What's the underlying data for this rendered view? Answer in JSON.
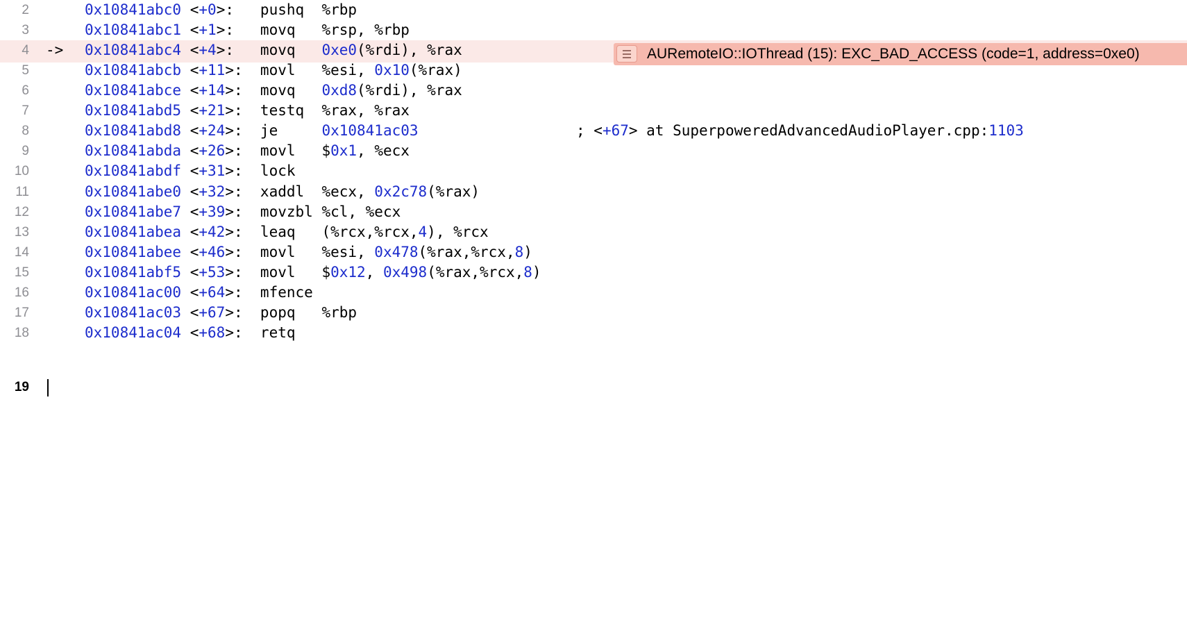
{
  "editor": {
    "lines": [
      {
        "num": "2",
        "arrow": "",
        "addr": "0x10841abc0",
        "offset_prefix": "<",
        "offset": "+0",
        "offset_suffix": ">:",
        "op": "pushq",
        "args": [
          {
            "t": "%rbp",
            "c": "plain"
          }
        ]
      },
      {
        "num": "3",
        "arrow": "",
        "addr": "0x10841abc1",
        "offset_prefix": "<",
        "offset": "+1",
        "offset_suffix": ">:",
        "op": "movq",
        "args": [
          {
            "t": "%rsp, %rbp",
            "c": "plain"
          }
        ]
      },
      {
        "num": "4",
        "arrow": "->",
        "addr": "0x10841abc4",
        "offset_prefix": "<",
        "offset": "+4",
        "offset_suffix": ">:",
        "op": "movq",
        "args": [
          {
            "t": "0xe0",
            "c": "num"
          },
          {
            "t": "(%rdi), %rax",
            "c": "plain"
          }
        ]
      },
      {
        "num": "5",
        "arrow": "",
        "addr": "0x10841abcb",
        "offset_prefix": "<",
        "offset": "+11",
        "offset_suffix": ">:",
        "op": "movl",
        "args": [
          {
            "t": "%esi, ",
            "c": "plain"
          },
          {
            "t": "0x10",
            "c": "num"
          },
          {
            "t": "(%rax)",
            "c": "plain"
          }
        ]
      },
      {
        "num": "6",
        "arrow": "",
        "addr": "0x10841abce",
        "offset_prefix": "<",
        "offset": "+14",
        "offset_suffix": ">:",
        "op": "movq",
        "args": [
          {
            "t": "0xd8",
            "c": "num"
          },
          {
            "t": "(%rdi), %rax",
            "c": "plain"
          }
        ]
      },
      {
        "num": "7",
        "arrow": "",
        "addr": "0x10841abd5",
        "offset_prefix": "<",
        "offset": "+21",
        "offset_suffix": ">:",
        "op": "testq",
        "args": [
          {
            "t": "%rax, %rax",
            "c": "plain"
          }
        ]
      },
      {
        "num": "8",
        "arrow": "",
        "addr": "0x10841abd8",
        "offset_prefix": "<",
        "offset": "+24",
        "offset_suffix": ">:",
        "op": "je",
        "args": [
          {
            "t": "0x10841ac03",
            "c": "num"
          }
        ]
      },
      {
        "num": "9",
        "arrow": "",
        "addr": "0x10841abda",
        "offset_prefix": "<",
        "offset": "+26",
        "offset_suffix": ">:",
        "op": "movl",
        "args": [
          {
            "t": "$",
            "c": "plain"
          },
          {
            "t": "0x1",
            "c": "num"
          },
          {
            "t": ", %ecx",
            "c": "plain"
          }
        ]
      },
      {
        "num": "10",
        "arrow": "",
        "addr": "0x10841abdf",
        "offset_prefix": "<",
        "offset": "+31",
        "offset_suffix": ">:",
        "op": "lock",
        "args": []
      },
      {
        "num": "11",
        "arrow": "",
        "addr": "0x10841abe0",
        "offset_prefix": "<",
        "offset": "+32",
        "offset_suffix": ">:",
        "op": "xaddl",
        "args": [
          {
            "t": "%ecx, ",
            "c": "plain"
          },
          {
            "t": "0x2c78",
            "c": "num"
          },
          {
            "t": "(%rax)",
            "c": "plain"
          }
        ]
      },
      {
        "num": "12",
        "arrow": "",
        "addr": "0x10841abe7",
        "offset_prefix": "<",
        "offset": "+39",
        "offset_suffix": ">:",
        "op": "movzbl",
        "args": [
          {
            "t": "%cl, %ecx",
            "c": "plain"
          }
        ]
      },
      {
        "num": "13",
        "arrow": "",
        "addr": "0x10841abea",
        "offset_prefix": "<",
        "offset": "+42",
        "offset_suffix": ">:",
        "op": "leaq",
        "args": [
          {
            "t": "(%rcx,%rcx,",
            "c": "plain"
          },
          {
            "t": "4",
            "c": "num"
          },
          {
            "t": "), %rcx",
            "c": "plain"
          }
        ]
      },
      {
        "num": "14",
        "arrow": "",
        "addr": "0x10841abee",
        "offset_prefix": "<",
        "offset": "+46",
        "offset_suffix": ">:",
        "op": "movl",
        "args": [
          {
            "t": "%esi, ",
            "c": "plain"
          },
          {
            "t": "0x478",
            "c": "num"
          },
          {
            "t": "(%rax,%rcx,",
            "c": "plain"
          },
          {
            "t": "8",
            "c": "num"
          },
          {
            "t": ")",
            "c": "plain"
          }
        ]
      },
      {
        "num": "15",
        "arrow": "",
        "addr": "0x10841abf5",
        "offset_prefix": "<",
        "offset": "+53",
        "offset_suffix": ">:",
        "op": "movl",
        "args": [
          {
            "t": "$",
            "c": "plain"
          },
          {
            "t": "0x12",
            "c": "num"
          },
          {
            "t": ", ",
            "c": "plain"
          },
          {
            "t": "0x498",
            "c": "num"
          },
          {
            "t": "(%rax,%rcx,",
            "c": "plain"
          },
          {
            "t": "8",
            "c": "num"
          },
          {
            "t": ")",
            "c": "plain"
          }
        ]
      },
      {
        "num": "16",
        "arrow": "",
        "addr": "0x10841ac00",
        "offset_prefix": "<",
        "offset": "+64",
        "offset_suffix": ">:",
        "op": "mfence",
        "args": []
      },
      {
        "num": "17",
        "arrow": "",
        "addr": "0x10841ac03",
        "offset_prefix": "<",
        "offset": "+67",
        "offset_suffix": ">:",
        "op": "popq",
        "args": [
          {
            "t": "%rbp",
            "c": "plain"
          }
        ]
      },
      {
        "num": "18",
        "arrow": "",
        "addr": "0x10841ac04",
        "offset_prefix": "<",
        "offset": "+68",
        "offset_suffix": ">:",
        "op": "retq",
        "args": []
      }
    ],
    "last_line_num": "19",
    "comment": {
      "prefix": "; <",
      "offset": "+67",
      "middle": "> at SuperpoweredAdvancedAudioPlayer.cpp:",
      "line": "1103"
    },
    "error": {
      "icon": "lines-icon",
      "message": "AURemoteIO::IOThread (15): EXC_BAD_ACCESS (code=1, address=0xe0)"
    },
    "colors": {
      "number": "#1c2ccc",
      "current_line_bg": "#fbe9e7",
      "error_banner_bg": "#f6b9ae"
    }
  }
}
